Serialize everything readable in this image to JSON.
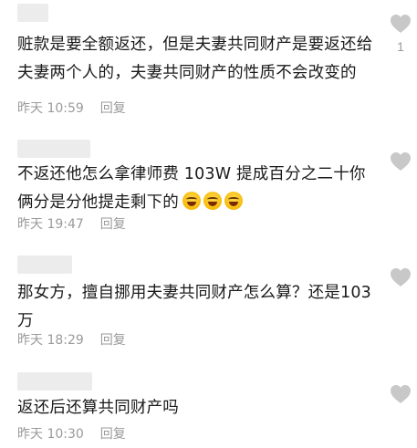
{
  "comments": [
    {
      "text": "赃款是要全额返还，但是夫妻共同财产是要返还给夫妻两个人的，夫妻共同财产的性质不会改变的",
      "time": "昨天 10:59",
      "reply_label": "回复",
      "likes": "1"
    },
    {
      "text": "不返还他怎么拿律师费 103W 提成百分之二十你俩分是分他提走剩下的",
      "emoji": [
        "rolling-on-floor-laughing-emoji",
        "rolling-on-floor-laughing-emoji",
        "rolling-on-floor-laughing-emoji"
      ],
      "time": "昨天 19:47",
      "reply_label": "回复",
      "likes": ""
    },
    {
      "text": "那女方，擅自挪用夫妻共同财产怎么算？还是103万",
      "time": "昨天 18:29",
      "reply_label": "回复",
      "likes": ""
    },
    {
      "text": "返还后还算共同财产吗",
      "time": "昨天 10:30",
      "reply_label": "回复",
      "likes": ""
    }
  ],
  "icons": {
    "like": "heart-icon",
    "like_color": "#c8c8c8"
  }
}
